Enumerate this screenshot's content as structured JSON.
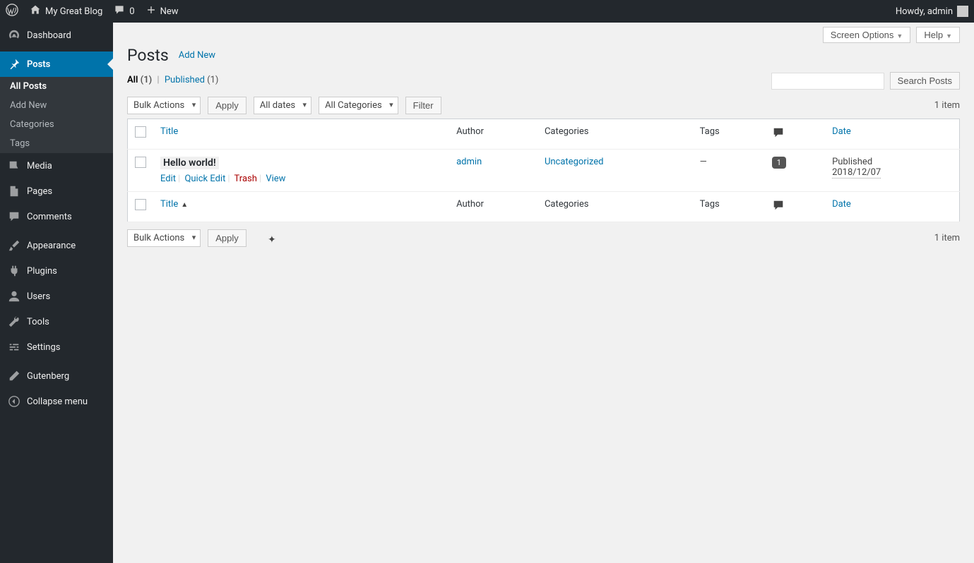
{
  "toolbar": {
    "site_name": "My Great Blog",
    "comments_count": "0",
    "new_label": "New",
    "greeting": "Howdy, admin"
  },
  "sidebar": {
    "items": [
      {
        "id": "dashboard",
        "label": "Dashboard"
      },
      {
        "id": "posts",
        "label": "Posts"
      },
      {
        "id": "media",
        "label": "Media"
      },
      {
        "id": "pages",
        "label": "Pages"
      },
      {
        "id": "comments",
        "label": "Comments"
      },
      {
        "id": "appearance",
        "label": "Appearance"
      },
      {
        "id": "plugins",
        "label": "Plugins"
      },
      {
        "id": "users",
        "label": "Users"
      },
      {
        "id": "tools",
        "label": "Tools"
      },
      {
        "id": "settings",
        "label": "Settings"
      },
      {
        "id": "gutenberg",
        "label": "Gutenberg"
      },
      {
        "id": "collapse",
        "label": "Collapse menu"
      }
    ],
    "submenu_posts": [
      {
        "label": "All Posts"
      },
      {
        "label": "Add New"
      },
      {
        "label": "Categories"
      },
      {
        "label": "Tags"
      }
    ]
  },
  "screen_actions": {
    "screen_options": "Screen Options",
    "help": "Help"
  },
  "heading": {
    "title": "Posts",
    "add_new": "Add New"
  },
  "subsubsub": {
    "all_label": "All",
    "all_count": "(1)",
    "published_label": "Published",
    "published_count": "(1)"
  },
  "filters": {
    "bulk_actions": "Bulk Actions",
    "apply": "Apply",
    "all_dates": "All dates",
    "all_categories": "All Categories",
    "filter": "Filter",
    "search_posts": "Search Posts",
    "item_count": "1 item"
  },
  "table": {
    "columns": {
      "title": "Title",
      "author": "Author",
      "categories": "Categories",
      "tags": "Tags",
      "date": "Date"
    },
    "rows": [
      {
        "title": "Hello world!",
        "author": "admin",
        "categories": "Uncategorized",
        "tags": "—",
        "comments": "1",
        "date_status": "Published",
        "date_value": "2018/12/07",
        "actions": {
          "edit": "Edit",
          "quick_edit": "Quick Edit",
          "trash": "Trash",
          "view": "View"
        }
      }
    ]
  }
}
